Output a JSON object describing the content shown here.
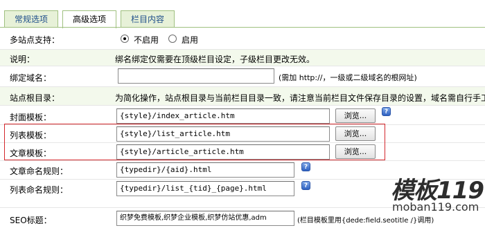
{
  "tabs": [
    {
      "label": "常规选项"
    },
    {
      "label": "高级选项"
    },
    {
      "label": "栏目内容"
    }
  ],
  "multisite": {
    "label": "多站点支持：",
    "opt1": "不启用",
    "opt2": "启用",
    "selected": "不启用"
  },
  "note": {
    "label": "说明：",
    "text": "绑名绑定仅需要在顶级栏目设定，子级栏目更改无效。"
  },
  "domain": {
    "label": "绑定域名：",
    "value": "",
    "hint": "(需加 http://，一级或二级域名的根网址)"
  },
  "siteroot": {
    "label": "站点根目录：",
    "text": "为简化操作，站点根目录与当前栏目目录一致，请注意当前栏目文件保存目录的设置，域名需自行手工"
  },
  "cover": {
    "label": "封面模板：",
    "value": "{style}/index_article.htm",
    "button": "浏览..."
  },
  "list": {
    "label": "列表模板：",
    "value": "{style}/list_article.htm",
    "button": "浏览..."
  },
  "article": {
    "label": "文章模板：",
    "value": "{style}/article_article.htm",
    "button": "浏览..."
  },
  "artname": {
    "label": "文章命名规则：",
    "value": "{typedir}/{aid}.html"
  },
  "listname": {
    "label": "列表命名规则：",
    "value": "{typedir}/list_{tid}_{page}.html"
  },
  "seo": {
    "label": "SEO标题：",
    "value": "织梦免费模板,织梦企业模板,织梦仿站优惠,adm",
    "hint": "(栏目模板里用{dede:field.seotitle /}调用)"
  },
  "watermark": {
    "brand": "模板119",
    "domain": "moban119.com"
  },
  "help_glyph": "?",
  "colors": {
    "accent_red": "#d4262b",
    "tab_green": "#e7f1d8",
    "tab_border": "#9fc07f",
    "link_blue": "#1f4f8a"
  }
}
